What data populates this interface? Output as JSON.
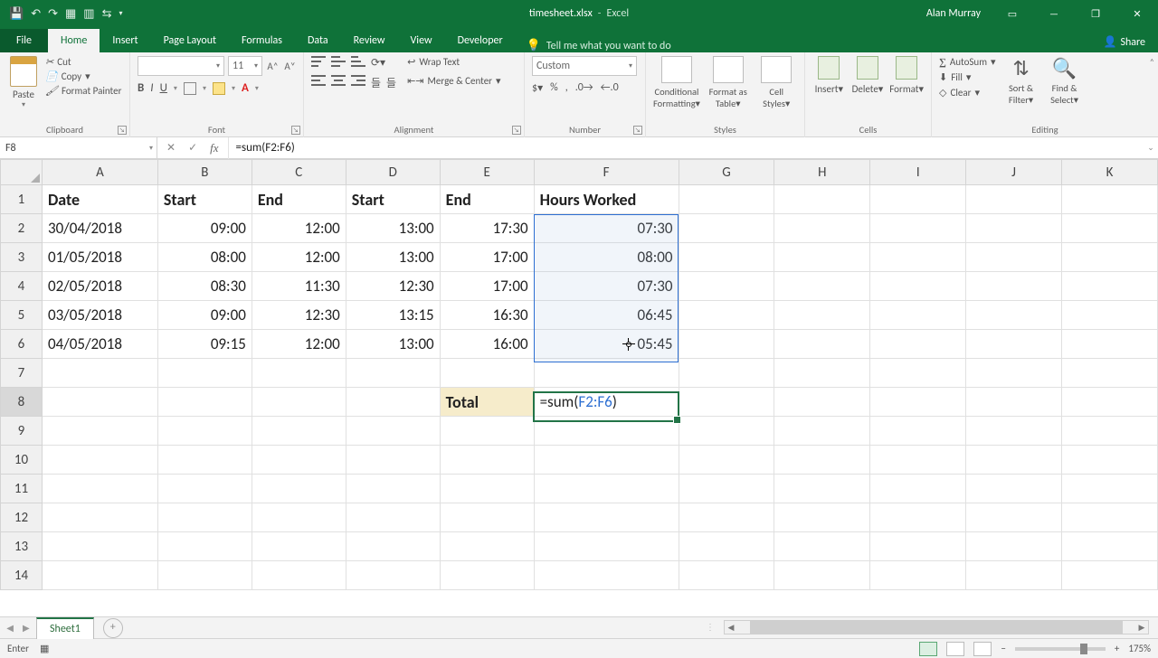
{
  "title": {
    "filename": "timesheet.xlsx",
    "app": "Excel",
    "user": "Alan Murray"
  },
  "tabs": {
    "file": "File",
    "home": "Home",
    "insert": "Insert",
    "pagelayout": "Page Layout",
    "formulas": "Formulas",
    "data": "Data",
    "review": "Review",
    "view": "View",
    "developer": "Developer",
    "tell": "Tell me what you want to do",
    "share": "Share"
  },
  "ribbon": {
    "clipboard": {
      "label": "Clipboard",
      "paste": "Paste",
      "cut": "Cut",
      "copy": "Copy",
      "painter": "Format Painter"
    },
    "font": {
      "label": "Font",
      "name": "",
      "size": "11"
    },
    "alignment": {
      "label": "Alignment",
      "wrap": "Wrap Text",
      "merge": "Merge & Center"
    },
    "number": {
      "label": "Number",
      "format": "Custom"
    },
    "styles": {
      "label": "Styles",
      "cond": "Conditional Formatting",
      "table": "Format as Table",
      "cell": "Cell Styles"
    },
    "cells": {
      "label": "Cells",
      "insert": "Insert",
      "delete": "Delete",
      "format": "Format"
    },
    "editing": {
      "label": "Editing",
      "autosum": "AutoSum",
      "fill": "Fill",
      "clear": "Clear",
      "sort": "Sort & Filter",
      "find": "Find & Select"
    }
  },
  "fbar": {
    "name": "F8",
    "formula": "=sum(F2:F6)"
  },
  "columns": [
    "A",
    "B",
    "C",
    "D",
    "E",
    "F",
    "G",
    "H",
    "I",
    "J",
    "K"
  ],
  "headers": {
    "A": "Date",
    "B": "Start",
    "C": "End",
    "D": "Start",
    "E": "End",
    "F": "Hours Worked"
  },
  "rows": [
    {
      "A": "30/04/2018",
      "B": "09:00",
      "C": "12:00",
      "D": "13:00",
      "E": "17:30",
      "F": "07:30"
    },
    {
      "A": "01/05/2018",
      "B": "08:00",
      "C": "12:00",
      "D": "13:00",
      "E": "17:00",
      "F": "08:00"
    },
    {
      "A": "02/05/2018",
      "B": "08:30",
      "C": "11:30",
      "D": "12:30",
      "E": "17:00",
      "F": "07:30"
    },
    {
      "A": "03/05/2018",
      "B": "09:00",
      "C": "12:30",
      "D": "13:15",
      "E": "16:30",
      "F": "06:45"
    },
    {
      "A": "04/05/2018",
      "B": "09:15",
      "C": "12:00",
      "D": "13:00",
      "E": "16:00",
      "F": "05:45"
    }
  ],
  "total": {
    "label": "Total",
    "formula_prefix": "=sum(",
    "formula_ref": "F2:F6",
    "formula_suffix": ")"
  },
  "sheetTab": "Sheet1",
  "status": {
    "mode": "Enter",
    "zoom": "175%"
  }
}
